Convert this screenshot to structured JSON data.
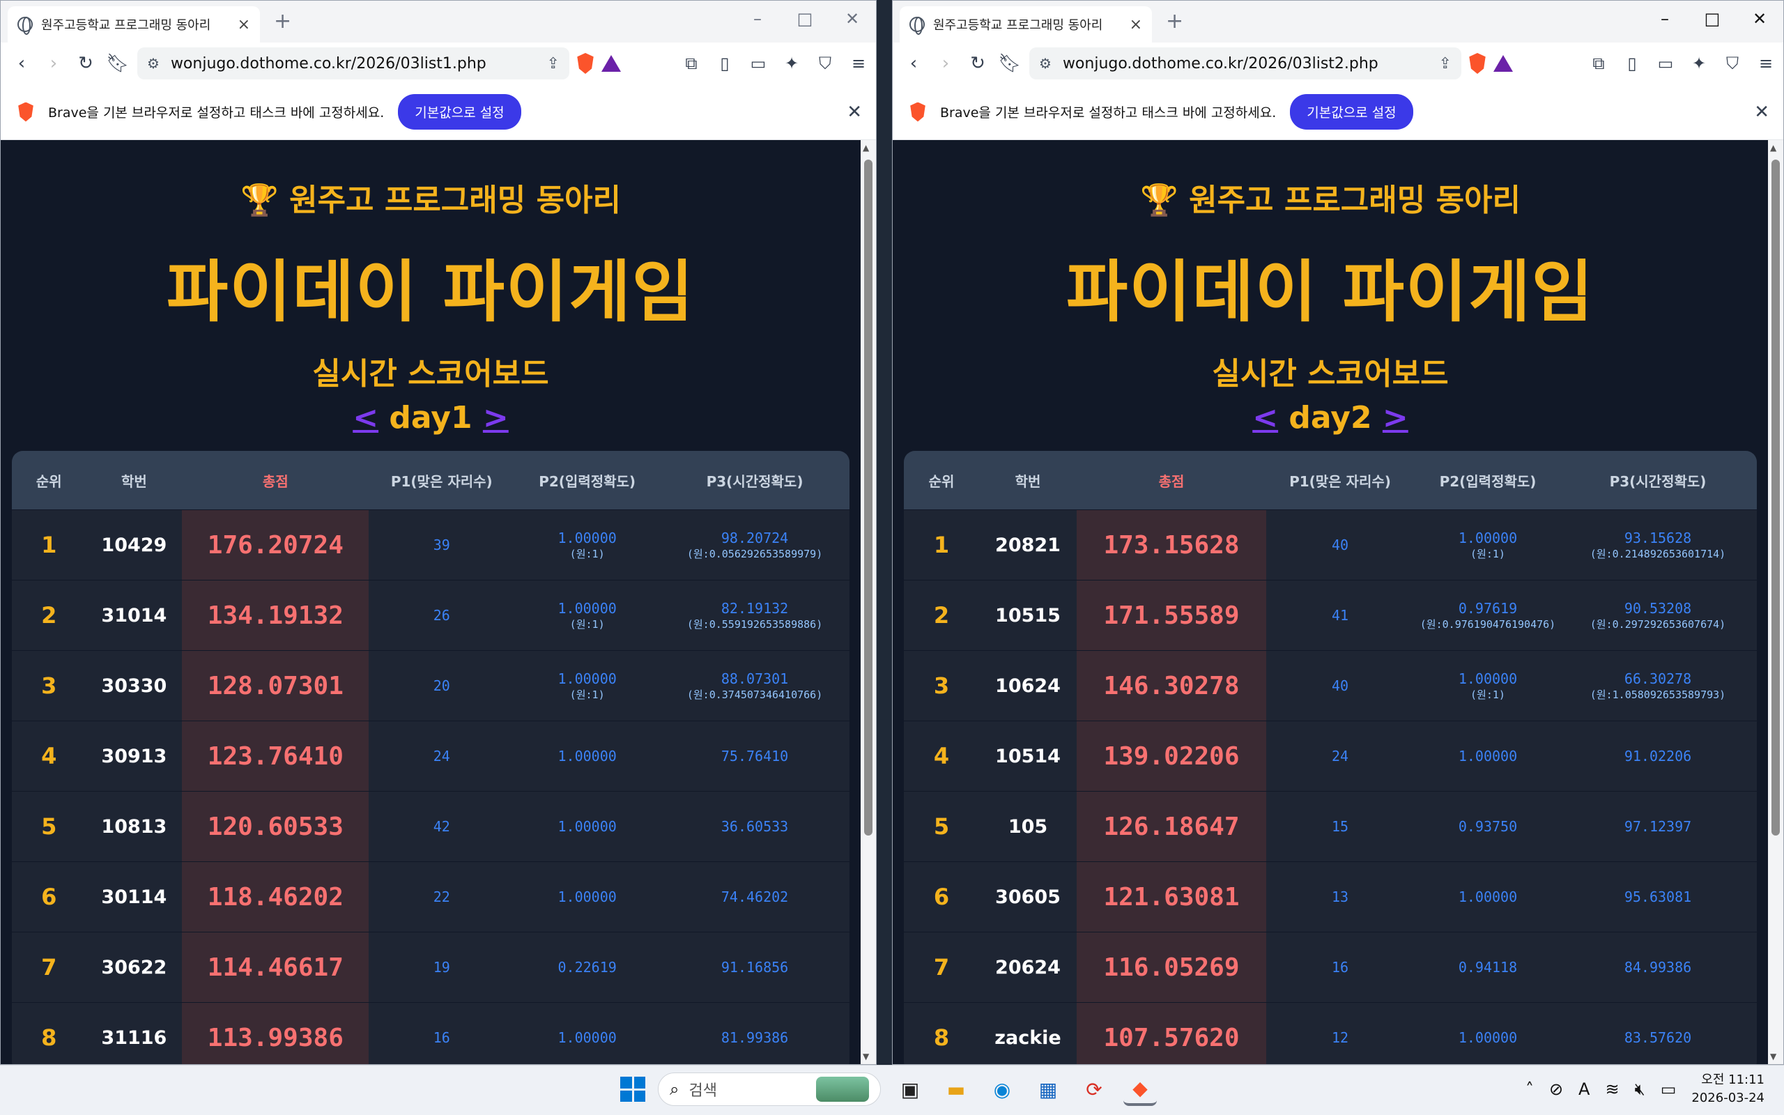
{
  "browser": {
    "tab_title": "원주고등학교 프로그래밍 동아리",
    "newtab": "+",
    "infobar_msg": "Brave을 기본 브라우저로 설정하고 태스크 바에 고정하세요.",
    "infobar_btn": "기본값으로 설정"
  },
  "left": {
    "url": "wonjugo.dothome.co.kr/2026/03list1.php",
    "club": "🏆 원주고 프로그래밍 동아리",
    "title": "파이데이 파이게임",
    "subtitle": "실시간 스코어보드",
    "day": "day1",
    "rows": [
      {
        "rank": "1",
        "sid": "10429",
        "total": "176.20724",
        "p1": "39",
        "p2": "1.00000",
        "p2o": "(원:1)",
        "p3": "98.20724",
        "p3o": "(원:0.056292653589979)"
      },
      {
        "rank": "2",
        "sid": "31014",
        "total": "134.19132",
        "p1": "26",
        "p2": "1.00000",
        "p2o": "(원:1)",
        "p3": "82.19132",
        "p3o": "(원:0.559192653589886)"
      },
      {
        "rank": "3",
        "sid": "30330",
        "total": "128.07301",
        "p1": "20",
        "p2": "1.00000",
        "p2o": "(원:1)",
        "p3": "88.07301",
        "p3o": "(원:0.374507346410766)"
      },
      {
        "rank": "4",
        "sid": "30913",
        "total": "123.76410",
        "p1": "24",
        "p2": "1.00000",
        "p2o": "",
        "p3": "75.76410",
        "p3o": ""
      },
      {
        "rank": "5",
        "sid": "10813",
        "total": "120.60533",
        "p1": "42",
        "p2": "1.00000",
        "p2o": "",
        "p3": "36.60533",
        "p3o": ""
      },
      {
        "rank": "6",
        "sid": "30114",
        "total": "118.46202",
        "p1": "22",
        "p2": "1.00000",
        "p2o": "",
        "p3": "74.46202",
        "p3o": ""
      },
      {
        "rank": "7",
        "sid": "30622",
        "total": "114.46617",
        "p1": "19",
        "p2": "0.22619",
        "p2o": "",
        "p3": "91.16856",
        "p3o": ""
      },
      {
        "rank": "8",
        "sid": "31116",
        "total": "113.99386",
        "p1": "16",
        "p2": "1.00000",
        "p2o": "",
        "p3": "81.99386",
        "p3o": ""
      }
    ]
  },
  "right": {
    "url": "wonjugo.dothome.co.kr/2026/03list2.php",
    "club": "🏆 원주고 프로그래밍 동아리",
    "title": "파이데이 파이게임",
    "subtitle": "실시간 스코어보드",
    "day": "day2",
    "rows": [
      {
        "rank": "1",
        "sid": "20821",
        "total": "173.15628",
        "p1": "40",
        "p2": "1.00000",
        "p2o": "(원:1)",
        "p3": "93.15628",
        "p3o": "(원:0.214892653601714)"
      },
      {
        "rank": "2",
        "sid": "10515",
        "total": "171.55589",
        "p1": "41",
        "p2": "0.97619",
        "p2o": "(원:0.976190476190476)",
        "p3": "90.53208",
        "p3o": "(원:0.297292653607674)"
      },
      {
        "rank": "3",
        "sid": "10624",
        "total": "146.30278",
        "p1": "40",
        "p2": "1.00000",
        "p2o": "(원:1)",
        "p3": "66.30278",
        "p3o": "(원:1.058092653589793)"
      },
      {
        "rank": "4",
        "sid": "10514",
        "total": "139.02206",
        "p1": "24",
        "p2": "1.00000",
        "p2o": "",
        "p3": "91.02206",
        "p3o": ""
      },
      {
        "rank": "5",
        "sid": "105",
        "total": "126.18647",
        "p1": "15",
        "p2": "0.93750",
        "p2o": "",
        "p3": "97.12397",
        "p3o": ""
      },
      {
        "rank": "6",
        "sid": "30605",
        "total": "121.63081",
        "p1": "13",
        "p2": "1.00000",
        "p2o": "",
        "p3": "95.63081",
        "p3o": ""
      },
      {
        "rank": "7",
        "sid": "20624",
        "total": "116.05269",
        "p1": "16",
        "p2": "0.94118",
        "p2o": "",
        "p3": "84.99386",
        "p3o": ""
      },
      {
        "rank": "8",
        "sid": "zackie",
        "total": "107.57620",
        "p1": "12",
        "p2": "1.00000",
        "p2o": "",
        "p3": "83.57620",
        "p3o": ""
      }
    ]
  },
  "table_headers": {
    "rank": "순위",
    "sid": "학번",
    "total": "총점",
    "p1": "P1(맞은 자리수)",
    "p2": "P2(입력정확도)",
    "p3": "P3(시간정확도)"
  },
  "taskbar": {
    "search_placeholder": "검색",
    "time": "오전 11:11",
    "date": "2026-03-24"
  },
  "colors": {
    "page_bg": "#111827",
    "accent": "#f5b31d",
    "total": "#f87171",
    "p_value": "#3b82f6"
  }
}
